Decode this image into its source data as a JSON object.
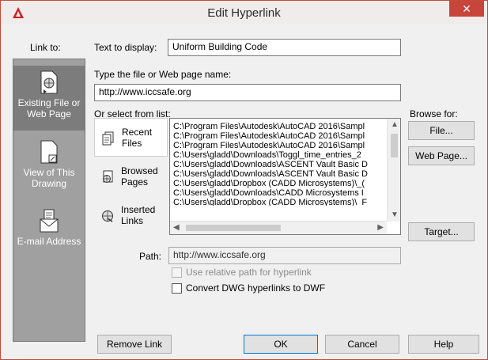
{
  "window": {
    "title": "Edit Hyperlink",
    "close_glyph": "✕"
  },
  "link_to": {
    "label": "Link to:",
    "items": [
      {
        "label_line1": "Existing File or",
        "label_line2": "Web Page",
        "icon": "globe-document-icon"
      },
      {
        "label_line1": "View of This",
        "label_line2": "Drawing",
        "icon": "drawing-view-icon"
      },
      {
        "label_line1": "E-mail Address",
        "label_line2": "",
        "icon": "envelope-icon"
      }
    ]
  },
  "text_to_display": {
    "label": "Text to display:",
    "value": "Uniform Building Code"
  },
  "file_or_web": {
    "label": "Type the file or Web page name:",
    "value": "http://www.iccsafe.org"
  },
  "select_from_list": {
    "label": "Or select from list:",
    "categories": [
      {
        "label_line1": "Recent",
        "label_line2": "Files"
      },
      {
        "label_line1": "Browsed",
        "label_line2": "Pages"
      },
      {
        "label_line1": "Inserted",
        "label_line2": "Links"
      }
    ],
    "rows": [
      "C:\\Program Files\\Autodesk\\AutoCAD 2016\\Sampl",
      "C:\\Program Files\\Autodesk\\AutoCAD 2016\\Sampl",
      "C:\\Program Files\\Autodesk\\AutoCAD 2016\\Sampl",
      "C:\\Users\\gladd\\Downloads\\Toggl_time_entries_2",
      "C:\\Users\\gladd\\Downloads\\ASCENT Vault Basic D",
      "C:\\Users\\gladd\\Downloads\\ASCENT Vault Basic D",
      "C:\\Users\\gladd\\Dropbox (CADD Microsystems)\\_(",
      "C:\\Users\\gladd\\Downloads\\CADD Microsystems I",
      "C:\\Users\\gladd\\Dropbox (CADD Microsystems)\\_F"
    ]
  },
  "browse_for": {
    "label": "Browse for:",
    "file_button": "File...",
    "web_page_button": "Web Page...",
    "target_button": "Target..."
  },
  "path": {
    "label": "Path:",
    "value": "http://www.iccsafe.org"
  },
  "options": {
    "relative_path": "Use relative path for hyperlink",
    "convert_dwg": "Convert DWG hyperlinks to DWF"
  },
  "footer": {
    "remove_link": "Remove Link",
    "ok": "OK",
    "cancel": "Cancel",
    "help": "Help"
  }
}
